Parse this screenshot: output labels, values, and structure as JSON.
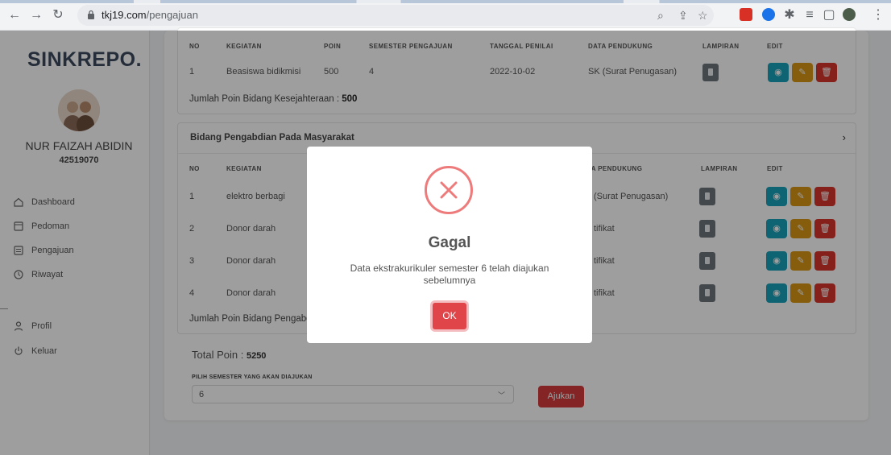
{
  "browser": {
    "url_host": "tkj19.com",
    "url_path": "/pengajuan"
  },
  "sidebar": {
    "brand": "SINKREPO.",
    "user_name": "NUR FAIZAH ABIDIN",
    "user_id": "42519070",
    "menu": [
      {
        "label": "Dashboard",
        "icon": "home-icon"
      },
      {
        "label": "Pedoman",
        "icon": "book-icon"
      },
      {
        "label": "Pengajuan",
        "icon": "form-icon"
      },
      {
        "label": "Riwayat",
        "icon": "history-icon"
      },
      {
        "label": "Profil",
        "icon": "user-icon"
      },
      {
        "label": "Keluar",
        "icon": "power-icon"
      }
    ]
  },
  "table_headers": {
    "no": "NO",
    "kegiatan": "KEGIATAN",
    "poin": "POIN",
    "semester": "SEMESTER PENGAJUAN",
    "tanggal": "TANGGAL PENILAI",
    "pendukung": "DATA PENDUKUNG",
    "lampiran": "LAMPIRAN",
    "edit": "EDIT",
    "pendukung_partial": "TA PENDUKUNG"
  },
  "section1": {
    "rows": [
      {
        "no": "1",
        "kegiatan": "Beasiswa bidikmisi",
        "poin": "500",
        "semester": "4",
        "tanggal": "2022-10-02",
        "pendukung": "SK (Surat Penugasan)"
      }
    ],
    "summary_label": "Jumlah Poin Bidang Kesejahteraan  :",
    "summary_value": "500"
  },
  "section2": {
    "title": "Bidang Pengabdian Pada Masyarakat",
    "rows": [
      {
        "no": "1",
        "kegiatan": "elektro berbagi",
        "pendukung": "(Surat Penugasan)"
      },
      {
        "no": "2",
        "kegiatan": "Donor darah",
        "pendukung": "tifikat"
      },
      {
        "no": "3",
        "kegiatan": "Donor darah",
        "pendukung": "tifikat"
      },
      {
        "no": "4",
        "kegiatan": "Donor darah",
        "pendukung": "tifikat"
      }
    ],
    "summary_label": "Jumlah Poin Bidang Pengabdi"
  },
  "total": {
    "label": "Total Poin :",
    "value": "5250"
  },
  "semester_select": {
    "label": "PILIH SEMESTER YANG AKAN DIAJUKAN",
    "value": "6",
    "submit_label": "Ajukan"
  },
  "modal": {
    "title": "Gagal",
    "message": "Data ekstrakurikuler semester 6 telah diajukan sebelumnya",
    "ok_label": "OK"
  },
  "colors": {
    "view": "#17a2b8",
    "edit": "#d89614",
    "delete": "#d9342b",
    "error": "#e0454a"
  }
}
